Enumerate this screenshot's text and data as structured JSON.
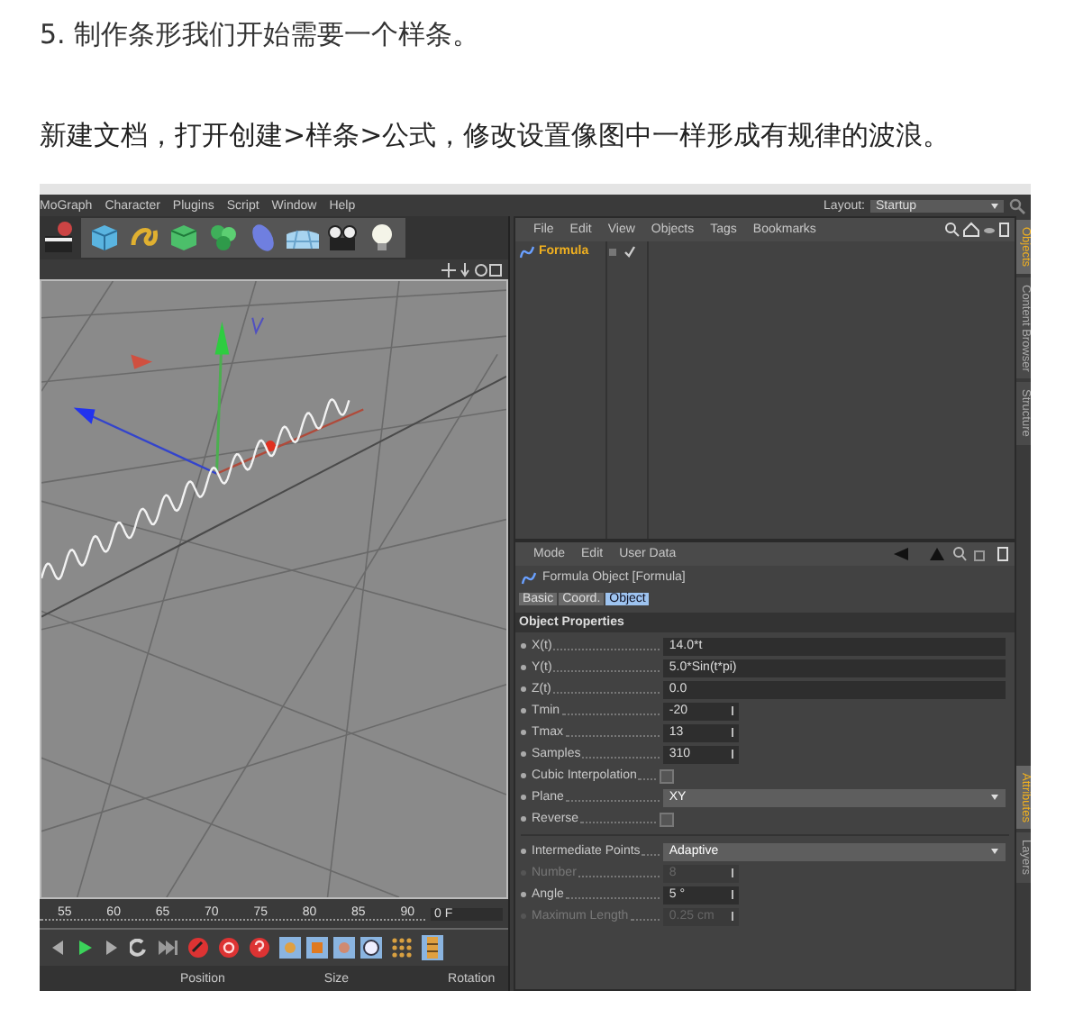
{
  "heading": "5. 制作条形我们开始需要一个样条。",
  "intro": "新建文档，打开创建>样条>公式，修改设置像图中一样形成有规律的波浪。",
  "app": {
    "menu": [
      "MoGraph",
      "Character",
      "Plugins",
      "Script",
      "Window",
      "Help"
    ],
    "layout": {
      "label": "Layout:",
      "value": "Startup"
    },
    "timeline": {
      "ticks": [
        "55",
        "60",
        "65",
        "70",
        "75",
        "80",
        "85",
        "90"
      ],
      "frame": "0 F"
    },
    "coord_headers": [
      "Position",
      "Size",
      "Rotation"
    ],
    "objects_panel": {
      "menu": [
        "File",
        "Edit",
        "View",
        "Objects",
        "Tags",
        "Bookmarks"
      ],
      "items": [
        {
          "name": "Formula",
          "selected": true
        }
      ]
    },
    "side_tabs_top": [
      {
        "label": "Objects",
        "selected": true
      },
      {
        "label": "Content Browser",
        "selected": false
      },
      {
        "label": "Structure",
        "selected": false
      }
    ],
    "attributes": {
      "menu": [
        "Mode",
        "Edit",
        "User Data"
      ],
      "title": "Formula Object [Formula]",
      "tabs": [
        {
          "label": "Basic",
          "selected": false
        },
        {
          "label": "Coord.",
          "selected": false
        },
        {
          "label": "Object",
          "selected": true
        }
      ],
      "section": "Object Properties",
      "rows": [
        {
          "kind": "field",
          "label": "X(t)",
          "value": "14.0*t",
          "disabled": false
        },
        {
          "kind": "field",
          "label": "Y(t)",
          "value": "5.0*Sin(t*pi)",
          "disabled": false
        },
        {
          "kind": "field",
          "label": "Z(t)",
          "value": "0.0",
          "disabled": false
        },
        {
          "kind": "number",
          "label": "Tmin",
          "value": "-20",
          "disabled": false
        },
        {
          "kind": "number",
          "label": "Tmax",
          "value": "13",
          "disabled": false
        },
        {
          "kind": "number",
          "label": "Samples",
          "value": "310",
          "disabled": false
        },
        {
          "kind": "checkbox",
          "label": "Cubic Interpolation",
          "checked": false,
          "disabled": false
        },
        {
          "kind": "dropdown",
          "label": "Plane",
          "value": "XY",
          "disabled": false
        },
        {
          "kind": "checkbox",
          "label": "Reverse",
          "checked": false,
          "disabled": false
        },
        {
          "kind": "divider"
        },
        {
          "kind": "dropdown",
          "label": "Intermediate Points",
          "value": "Adaptive",
          "disabled": false
        },
        {
          "kind": "number",
          "label": "Number",
          "value": "8",
          "disabled": true
        },
        {
          "kind": "number",
          "label": "Angle",
          "value": "5 °",
          "disabled": false
        },
        {
          "kind": "number",
          "label": "Maximum Length",
          "value": "0.25 cm",
          "disabled": true
        }
      ]
    },
    "side_tabs_bottom": [
      {
        "label": "Attributes",
        "selected": true
      },
      {
        "label": "Layers",
        "selected": false
      }
    ]
  }
}
